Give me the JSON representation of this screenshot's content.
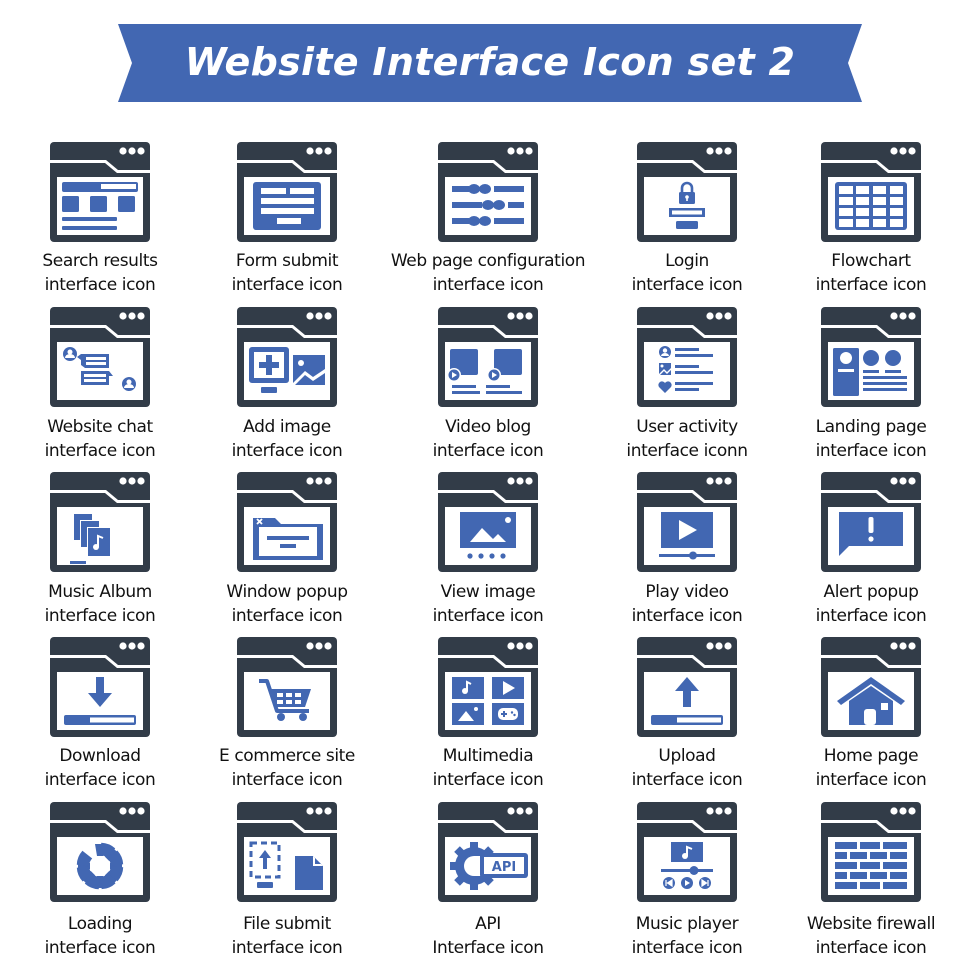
{
  "title": "Website Interface Icon set 2",
  "colors": {
    "accent": "#4267b2",
    "dark": "#323c48",
    "banner": "#4267b2",
    "text": "#111111",
    "background": "#ffffff"
  },
  "icons": [
    {
      "id": "search-results",
      "icon": "search-results-icon",
      "line1": "Search results",
      "line2": "interface icon"
    },
    {
      "id": "form-submit",
      "icon": "form-submit-icon",
      "line1": "Form submit",
      "line2": "interface icon"
    },
    {
      "id": "web-page-configuration",
      "icon": "sliders-icon",
      "line1": "Web page configuration",
      "line2": "interface icon"
    },
    {
      "id": "login",
      "icon": "lock-icon",
      "line1": "Login",
      "line2": "interface icon"
    },
    {
      "id": "flowchart",
      "icon": "table-grid-icon",
      "line1": "Flowchart",
      "line2": "interface icon"
    },
    {
      "id": "website-chat",
      "icon": "chat-icon",
      "line1": "Website chat",
      "line2": "interface icon"
    },
    {
      "id": "add-image",
      "icon": "add-image-icon",
      "line1": "Add image",
      "line2": "interface icon"
    },
    {
      "id": "video-blog",
      "icon": "video-blog-icon",
      "line1": "Video blog",
      "line2": "interface icon"
    },
    {
      "id": "user-activity",
      "icon": "user-activity-icon",
      "line1": "User activity",
      "line2": "interface iconn"
    },
    {
      "id": "landing-page",
      "icon": "landing-page-icon",
      "line1": "Landing page",
      "line2": "interface icon"
    },
    {
      "id": "music-album",
      "icon": "music-album-icon",
      "line1": "Music Album",
      "line2": "interface icon"
    },
    {
      "id": "window-popup",
      "icon": "window-popup-icon",
      "line1": "Window popup",
      "line2": "interface icon"
    },
    {
      "id": "view-image",
      "icon": "view-image-icon",
      "line1": "View image",
      "line2": "interface icon"
    },
    {
      "id": "play-video",
      "icon": "play-video-icon",
      "line1": "Play video",
      "line2": "interface icon"
    },
    {
      "id": "alert-popup",
      "icon": "alert-icon",
      "line1": "Alert popup",
      "line2": "interface icon"
    },
    {
      "id": "download",
      "icon": "download-icon",
      "line1": "Download",
      "line2": "interface icon"
    },
    {
      "id": "e-commerce-site",
      "icon": "shopping-cart-icon",
      "line1": "E commerce site",
      "line2": "interface icon"
    },
    {
      "id": "multimedia",
      "icon": "multimedia-icon",
      "line1": "Multimedia",
      "line2": "interface icon"
    },
    {
      "id": "upload",
      "icon": "upload-icon",
      "line1": "Upload",
      "line2": "interface icon"
    },
    {
      "id": "home-page",
      "icon": "home-icon",
      "line1": "Home page",
      "line2": "interface icon"
    },
    {
      "id": "loading",
      "icon": "loading-spinner-icon",
      "line1": "Loading",
      "line2": "interface icon"
    },
    {
      "id": "file-submit",
      "icon": "file-submit-icon",
      "line1": "File submit",
      "line2": "interface icon"
    },
    {
      "id": "api",
      "icon": "api-gear-icon",
      "line1": "API",
      "line2": "Interface icon",
      "badge": "API"
    },
    {
      "id": "music-player",
      "icon": "music-player-icon",
      "line1": "Music player",
      "line2": "interface icon"
    },
    {
      "id": "website-firewall",
      "icon": "firewall-icon",
      "line1": "Website firewall",
      "line2": "interface icon"
    }
  ]
}
